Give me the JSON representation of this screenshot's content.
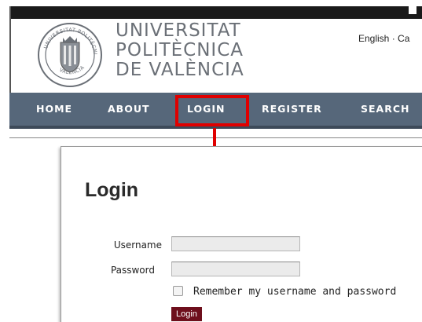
{
  "header": {
    "logo": {
      "line1": "UNIVERSITAT",
      "line2": "POLITÈCNICA",
      "line3": "DE VALÈNCIA",
      "seal_text_top": "UNIVERSITAT POLITÈCNICA",
      "seal_text_bottom": "VALENCIA"
    },
    "language_text": "English · Ca"
  },
  "nav": {
    "items": [
      {
        "label": "HOME"
      },
      {
        "label": "ABOUT"
      },
      {
        "label": "LOGIN"
      },
      {
        "label": "REGISTER"
      },
      {
        "label": "SEARCH"
      }
    ],
    "highlighted_item": "LOGIN"
  },
  "login": {
    "title": "Login",
    "username_label": "Username",
    "username_value": "",
    "password_label": "Password",
    "password_value": "",
    "remember_label": "Remember my username and password",
    "remember_checked": false,
    "submit_label": "Login"
  },
  "colors": {
    "nav_bg": "#56677a",
    "highlight": "#e00000",
    "button_bg": "#6e0f1c",
    "logo_text": "#6b7077"
  },
  "icons": [
    "university-seal-icon",
    "red-arrow-down-icon",
    "checkbox-icon"
  ]
}
